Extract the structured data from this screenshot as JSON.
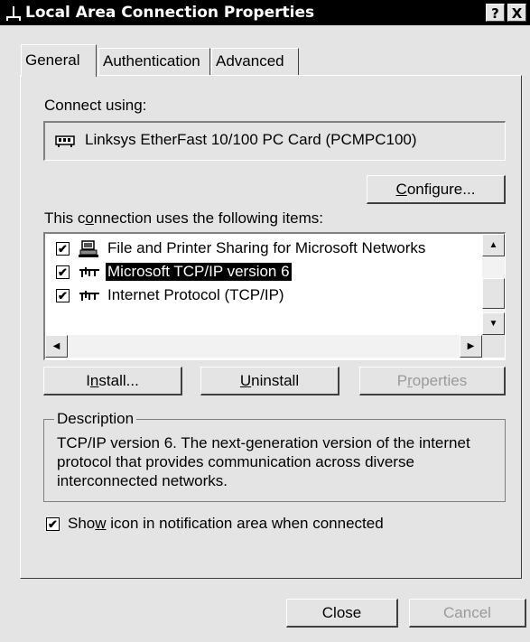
{
  "window": {
    "title": "Local Area Connection Properties",
    "help_label": "?",
    "close_label": "X"
  },
  "tabs": [
    {
      "label": "General",
      "selected": true
    },
    {
      "label": "Authentication",
      "selected": false
    },
    {
      "label": "Advanced",
      "selected": false
    }
  ],
  "general": {
    "connect_using_label": "Connect using:",
    "adapter_name": "Linksys EtherFast 10/100 PC Card (PCMPC100)",
    "configure_button": {
      "pre": "",
      "accel": "C",
      "post": "onfigure..."
    },
    "items_label": {
      "pre": "This c",
      "accel": "o",
      "post": "nnection uses the following items:"
    },
    "items": [
      {
        "label": "File and Printer Sharing for Microsoft Networks",
        "checked": true,
        "icon": "network-service-icon",
        "selected": false
      },
      {
        "label": "Microsoft TCP/IP version 6",
        "checked": true,
        "icon": "protocol-icon",
        "selected": true
      },
      {
        "label": "Internet Protocol (TCP/IP)",
        "checked": true,
        "icon": "protocol-icon",
        "selected": false
      }
    ],
    "install_button": {
      "pre": "I",
      "accel": "n",
      "post": "stall..."
    },
    "uninstall_button": {
      "pre": "",
      "accel": "U",
      "post": "ninstall"
    },
    "properties_button": {
      "pre": "P",
      "accel": "r",
      "post": "operties",
      "disabled": true
    },
    "description_legend": "Description",
    "description_text": "TCP/IP version 6. The next-generation version of the internet protocol that provides communication across diverse interconnected networks.",
    "notify_checkbox": {
      "pre": "Sho",
      "accel": "w",
      "post": " icon in notification area when connected",
      "checked": true
    }
  },
  "footer": {
    "close_button": "Close",
    "cancel_button": "Cancel",
    "cancel_disabled": true
  },
  "scroll": {
    "up_arrow": "▲",
    "down_arrow": "▼",
    "left_arrow": "◀",
    "right_arrow": "▶"
  },
  "checkmark": "✔",
  "colors": {
    "titlebar": "#000000",
    "dialog": "#e4e4e4",
    "selection": "#000000"
  }
}
